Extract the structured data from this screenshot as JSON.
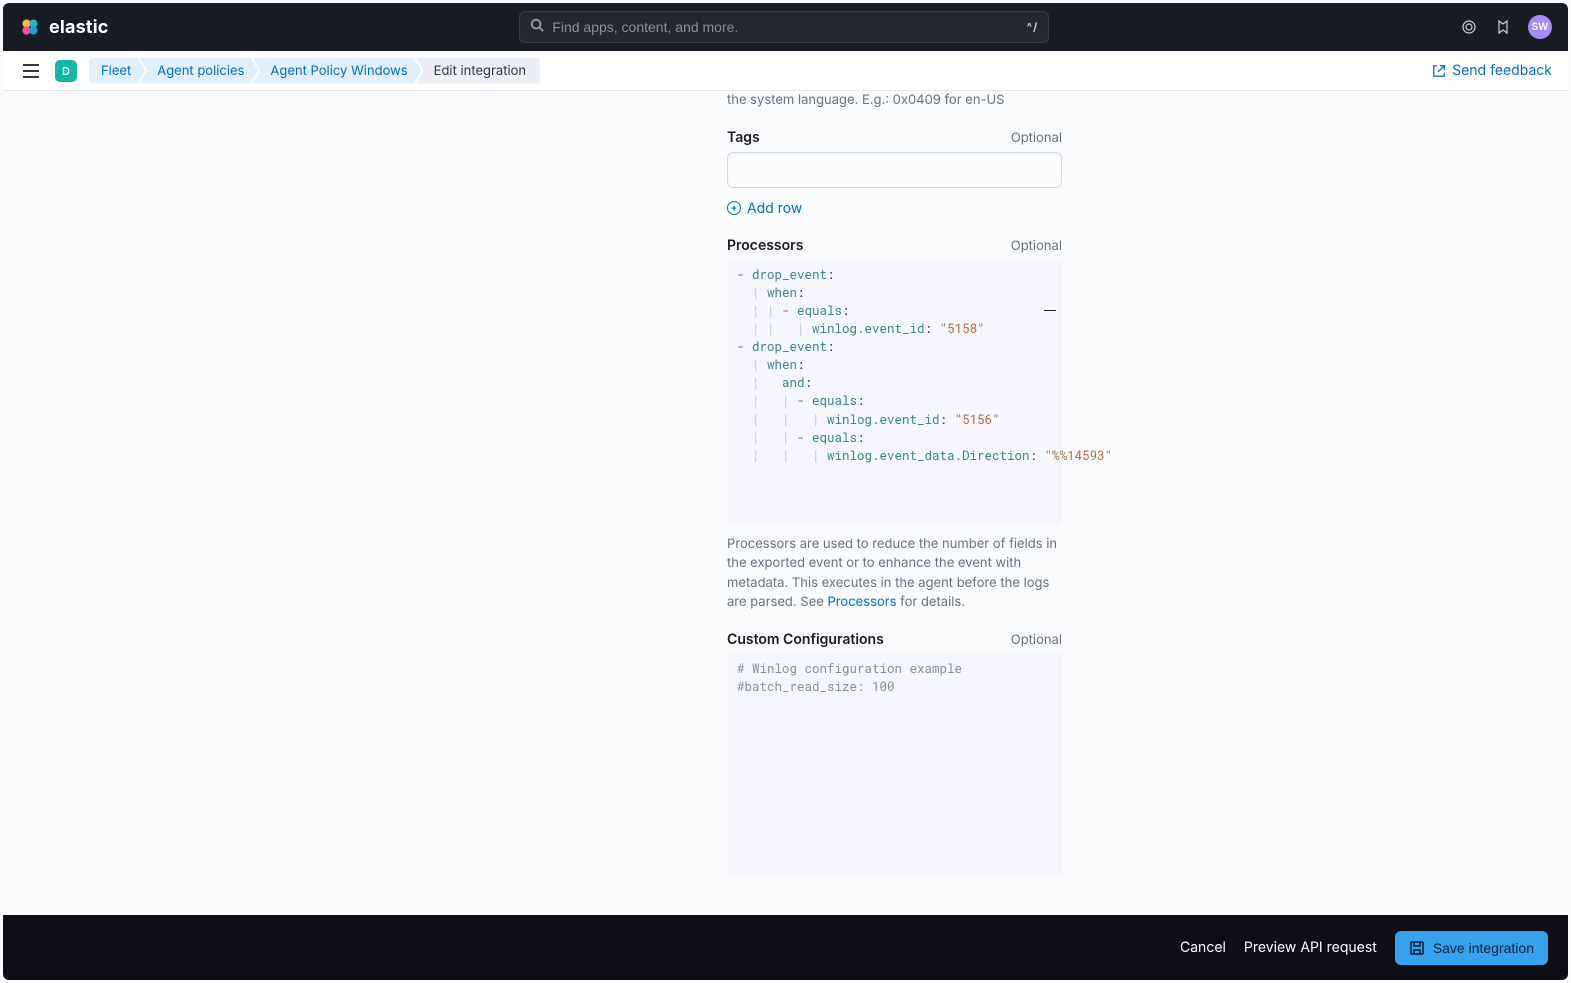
{
  "header": {
    "brand": "elastic",
    "search_placeholder": "Find apps, content, and more.",
    "search_shortcut": "^/",
    "avatar_initials": "SW"
  },
  "subheader": {
    "space_initial": "D",
    "crumbs": [
      "Fleet",
      "Agent policies",
      "Agent Policy Windows",
      "Edit integration"
    ],
    "feedback_label": "Send feedback"
  },
  "form": {
    "locale_hint": "the system language. E.g.: 0x0409 for en-US",
    "tags": {
      "label": "Tags",
      "optional": "Optional",
      "value": ""
    },
    "add_row": "Add row",
    "processors": {
      "label": "Processors",
      "optional": "Optional",
      "code": [
        {
          "t": "dash",
          "v": "- "
        },
        {
          "t": "key",
          "v": "drop_event"
        },
        {
          "t": "plain",
          "v": ":"
        },
        {
          "t": "nl"
        },
        {
          "t": "guide",
          "v": "  | "
        },
        {
          "t": "key",
          "v": "when"
        },
        {
          "t": "plain",
          "v": ":"
        },
        {
          "t": "nl"
        },
        {
          "t": "guide",
          "v": "  | | "
        },
        {
          "t": "dash",
          "v": "- "
        },
        {
          "t": "key",
          "v": "equals"
        },
        {
          "t": "plain",
          "v": ":"
        },
        {
          "t": "nl"
        },
        {
          "t": "guide",
          "v": "  | |   | "
        },
        {
          "t": "key",
          "v": "winlog.event_id"
        },
        {
          "t": "plain",
          "v": ": "
        },
        {
          "t": "str",
          "v": "\"5158\""
        },
        {
          "t": "nl"
        },
        {
          "t": "dash",
          "v": "- "
        },
        {
          "t": "key",
          "v": "drop_event"
        },
        {
          "t": "plain",
          "v": ":"
        },
        {
          "t": "nl"
        },
        {
          "t": "guide",
          "v": "  | "
        },
        {
          "t": "key",
          "v": "when"
        },
        {
          "t": "plain",
          "v": ":"
        },
        {
          "t": "nl"
        },
        {
          "t": "guide",
          "v": "  |   "
        },
        {
          "t": "key",
          "v": "and"
        },
        {
          "t": "plain",
          "v": ":"
        },
        {
          "t": "nl"
        },
        {
          "t": "guide",
          "v": "  |   | "
        },
        {
          "t": "dash",
          "v": "- "
        },
        {
          "t": "key",
          "v": "equals"
        },
        {
          "t": "plain",
          "v": ":"
        },
        {
          "t": "nl"
        },
        {
          "t": "guide",
          "v": "  |   |   | "
        },
        {
          "t": "key",
          "v": "winlog.event_id"
        },
        {
          "t": "plain",
          "v": ": "
        },
        {
          "t": "str",
          "v": "\"5156\""
        },
        {
          "t": "nl"
        },
        {
          "t": "guide",
          "v": "  |   | "
        },
        {
          "t": "dash",
          "v": "- "
        },
        {
          "t": "key",
          "v": "equals"
        },
        {
          "t": "plain",
          "v": ":"
        },
        {
          "t": "nl"
        },
        {
          "t": "guide",
          "v": "  |   |   | "
        },
        {
          "t": "key",
          "v": "winlog.event_data.Direction"
        },
        {
          "t": "plain",
          "v": ": "
        },
        {
          "t": "str",
          "v": "\"%%14593\""
        }
      ],
      "help_pre": "Processors are used to reduce the number of fields in the exported event or to enhance the event with metadata. This executes in the agent before the logs are parsed. See ",
      "help_link": "Processors",
      "help_post": " for details."
    },
    "custom": {
      "label": "Custom Configurations",
      "optional": "Optional",
      "line1": "# Winlog configuration example",
      "line2": "#batch_read_size: 100"
    }
  },
  "footer": {
    "cancel": "Cancel",
    "preview": "Preview API request",
    "save": "Save integration"
  }
}
